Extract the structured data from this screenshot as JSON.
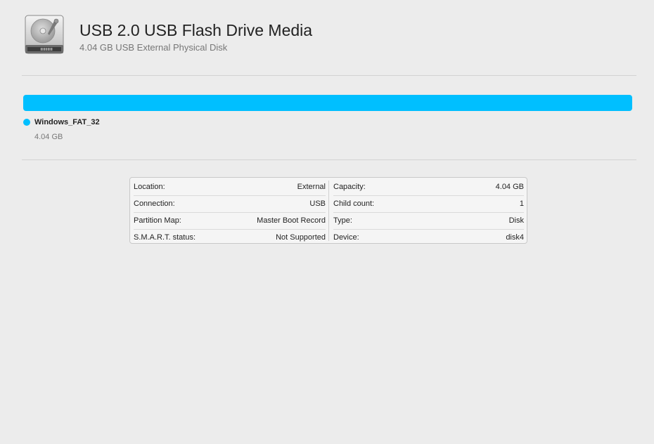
{
  "header": {
    "icon": "external-disk-icon",
    "title": "USB 2.0 USB Flash Drive Media",
    "subtitle": "4.04 GB USB External Physical Disk"
  },
  "usage": {
    "bar_color": "#00bfff",
    "fill_fraction": 1.0,
    "partitions": [
      {
        "name": "Windows_FAT_32",
        "size": "4.04 GB",
        "color": "#00bfff"
      }
    ]
  },
  "info": {
    "left": [
      {
        "label": "Location:",
        "value": "External"
      },
      {
        "label": "Connection:",
        "value": "USB"
      },
      {
        "label": "Partition Map:",
        "value": "Master Boot Record"
      },
      {
        "label": "S.M.A.R.T. status:",
        "value": "Not Supported"
      }
    ],
    "right": [
      {
        "label": "Capacity:",
        "value": "4.04 GB"
      },
      {
        "label": "Child count:",
        "value": "1"
      },
      {
        "label": "Type:",
        "value": "Disk"
      },
      {
        "label": "Device:",
        "value": "disk4"
      }
    ]
  }
}
